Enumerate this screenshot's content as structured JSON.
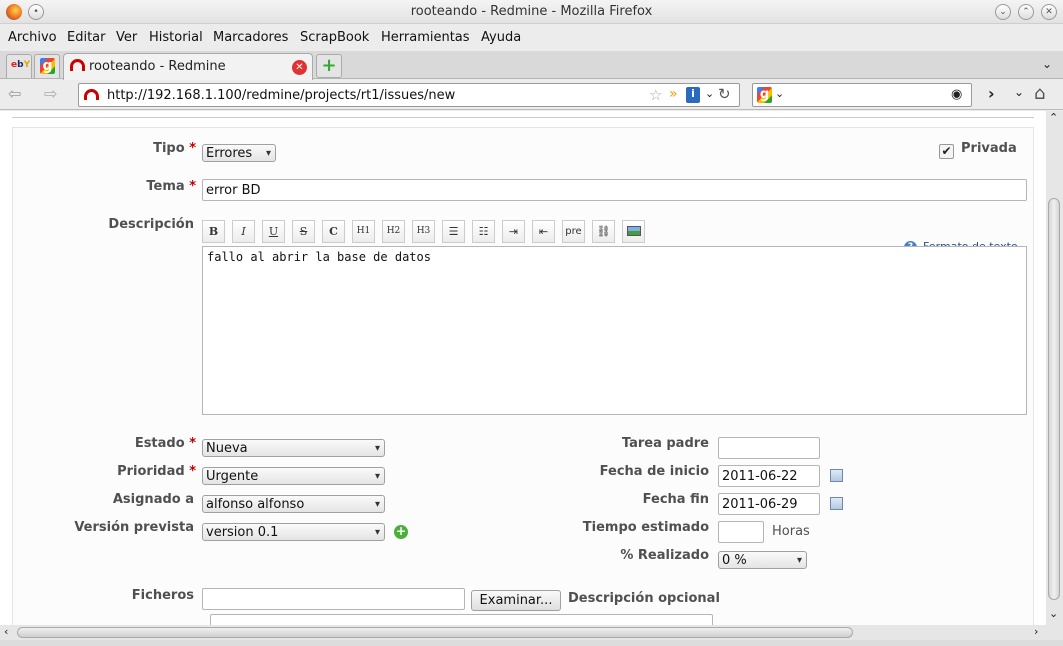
{
  "window": {
    "title": "rooteando - Redmine - Mozilla Firefox"
  },
  "menu": {
    "items": [
      "Archivo",
      "Editar",
      "Ver",
      "Historial",
      "Marcadores",
      "ScrapBook",
      "Herramientas",
      "Ayuda"
    ]
  },
  "tabs": {
    "active_label": "rooteando - Redmine",
    "pinned_icons": [
      "ebay-icon",
      "google-icon"
    ]
  },
  "nav": {
    "url": "http://192.168.1.100/redmine/projects/rt1/issues/new"
  },
  "form": {
    "tipo_label": "Tipo",
    "tipo_value": "Errores",
    "privada_label": "Privada",
    "privada_checked": true,
    "tema_label": "Tema",
    "tema_value": "error BD",
    "descripcion_label": "Descripción",
    "toolbar": [
      "B",
      "I",
      "U",
      "S",
      "C",
      "H1",
      "H2",
      "H3",
      "ul",
      "ol",
      "indent",
      "outdent",
      "pre",
      "link",
      "image"
    ],
    "formato_link": "Formato de texto",
    "descripcion_value": "fallo al abrir la base de datos",
    "estado_label": "Estado",
    "estado_value": "Nueva",
    "prioridad_label": "Prioridad",
    "prioridad_value": "Urgente",
    "asignado_label": "Asignado a",
    "asignado_value": "alfonso alfonso",
    "version_label": "Versión prevista",
    "version_value": "version 0.1",
    "tarea_padre_label": "Tarea padre",
    "tarea_padre_value": "",
    "fecha_inicio_label": "Fecha de inicio",
    "fecha_inicio_value": "2011-06-22",
    "fecha_fin_label": "Fecha fin",
    "fecha_fin_value": "2011-06-29",
    "tiempo_label": "Tiempo estimado",
    "tiempo_value": "",
    "horas_label": "Horas",
    "realizado_label": "% Realizado",
    "realizado_value": "0 %",
    "ficheros_label": "Ficheros",
    "examinar_button": "Examinar...",
    "descripcion_opcional": "Descripción opcional",
    "required_mark": "*"
  }
}
